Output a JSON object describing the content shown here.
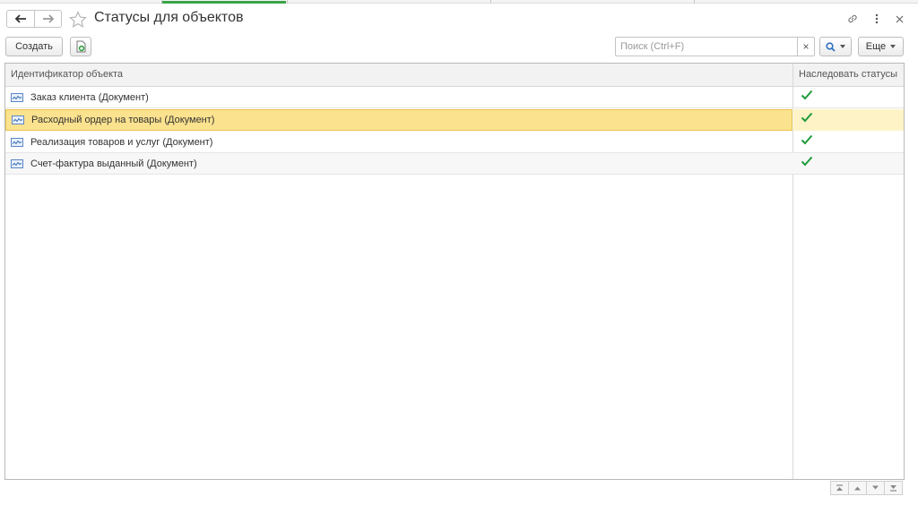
{
  "header": {
    "title": "Статусы для объектов",
    "icons": {
      "back": "arrow-left-icon",
      "forward": "arrow-right-icon",
      "favorite": "star-icon",
      "link": "link-icon",
      "more": "vertical-dots-icon",
      "close": "close-icon"
    }
  },
  "toolbar": {
    "create_label": "Создать",
    "copy_icon": "add-copy-icon",
    "search": {
      "value": "",
      "placeholder": "Поиск (Ctrl+F)",
      "clear": "×"
    },
    "search_button_icon": "search-icon",
    "more_label": "Еще"
  },
  "table": {
    "columns": [
      "Идентификатор объекта",
      "Наследовать статусы"
    ],
    "rows": [
      {
        "name": "Заказ клиента (Документ)",
        "inherit": true,
        "selected": false
      },
      {
        "name": "Расходный ордер на товары (Документ)",
        "inherit": true,
        "selected": true
      },
      {
        "name": "Реализация товаров и услуг (Документ)",
        "inherit": true,
        "selected": false
      },
      {
        "name": "Счет-фактура выданный (Документ)",
        "inherit": true,
        "selected": false
      }
    ]
  },
  "pager": {
    "icons": [
      "scroll-top-icon",
      "scroll-up-icon",
      "scroll-down-icon",
      "scroll-bottom-icon"
    ]
  },
  "colors": {
    "accent_green": "#3aa547",
    "check_green": "#1f9c3c",
    "selected_row": "#fbe28e",
    "search_icon_blue": "#2d6fc4"
  }
}
